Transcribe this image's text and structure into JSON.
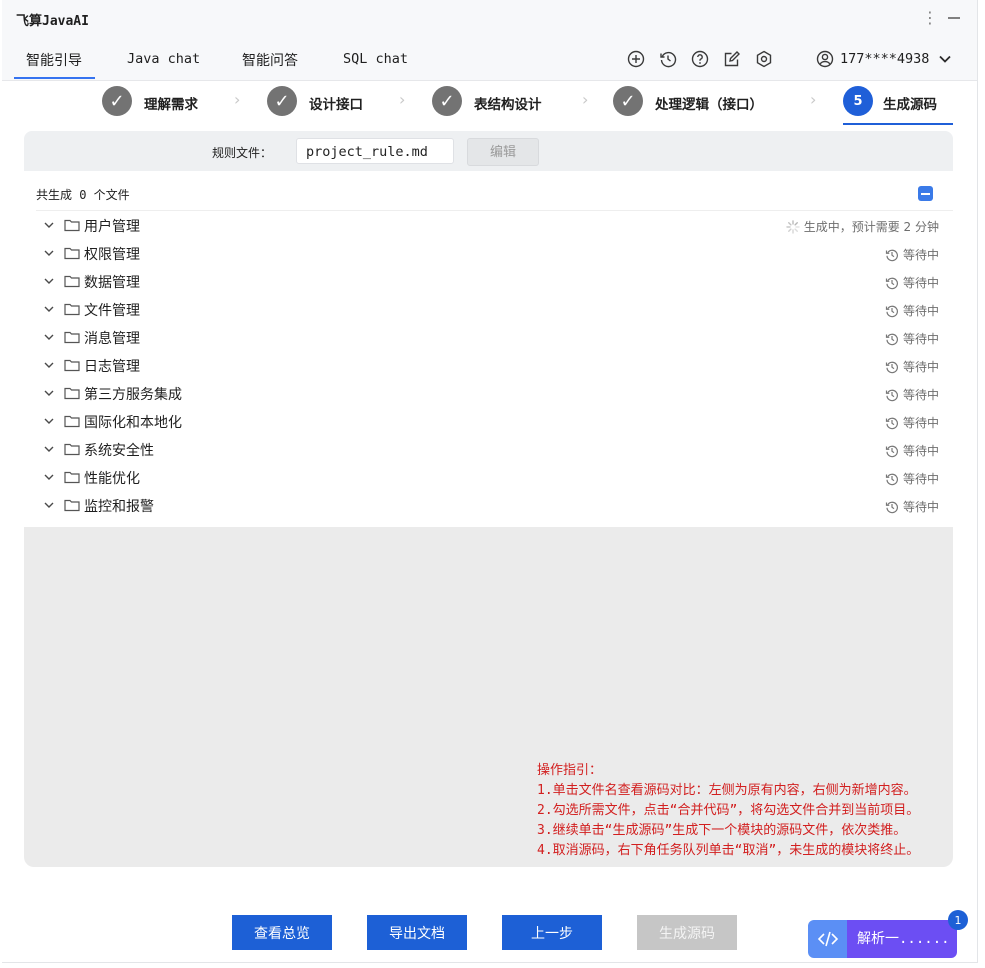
{
  "app": {
    "title": "飞算JavaAI"
  },
  "tabs": [
    {
      "label": "智能引导",
      "active": true
    },
    {
      "label": "Java chat"
    },
    {
      "label": "智能问答"
    },
    {
      "label": "SQL chat"
    }
  ],
  "toolbar": {
    "icons": [
      "add-circle-icon",
      "history-icon",
      "help-icon",
      "edit-icon",
      "settings-icon"
    ],
    "user_phone": "177****4938"
  },
  "steps": [
    {
      "label": "理解需求",
      "state": "done"
    },
    {
      "label": "设计接口",
      "state": "done"
    },
    {
      "label": "表结构设计",
      "state": "done"
    },
    {
      "label": "处理逻辑（接口）",
      "state": "done"
    },
    {
      "label": "生成源码",
      "state": "active",
      "number": "5"
    }
  ],
  "rule": {
    "label": "规则文件：",
    "value": "project_rule.md",
    "edit_label": "编辑"
  },
  "summary": "共生成 0 个文件",
  "modules": [
    {
      "name": "用户管理",
      "status": "生成中，预计需要 2 分钟",
      "state": "generating"
    },
    {
      "name": "权限管理",
      "status": "等待中",
      "state": "waiting"
    },
    {
      "name": "数据管理",
      "status": "等待中",
      "state": "waiting"
    },
    {
      "name": "文件管理",
      "status": "等待中",
      "state": "waiting"
    },
    {
      "name": "消息管理",
      "status": "等待中",
      "state": "waiting"
    },
    {
      "name": "日志管理",
      "status": "等待中",
      "state": "waiting"
    },
    {
      "name": "第三方服务集成",
      "status": "等待中",
      "state": "waiting"
    },
    {
      "name": "国际化和本地化",
      "status": "等待中",
      "state": "waiting"
    },
    {
      "name": "系统安全性",
      "status": "等待中",
      "state": "waiting"
    },
    {
      "name": "性能优化",
      "status": "等待中",
      "state": "waiting"
    },
    {
      "name": "监控和报警",
      "status": "等待中",
      "state": "waiting"
    }
  ],
  "guide": {
    "title": "操作指引：",
    "lines": [
      "1.单击文件名查看源码对比：左侧为原有内容，右侧为新增内容。",
      "2.勾选所需文件，点击“合并代码”，将勾选文件合并到当前项目。",
      "3.继续单击“生成源码”生成下一个模块的源码文件，依次类推。",
      "4.取消源码，右下角任务队列单击“取消”，未生成的模块将终止。"
    ]
  },
  "buttons": {
    "overview": "查看总览",
    "export": "导出文档",
    "prev": "上一步",
    "generate": "生成源码"
  },
  "task_queue": {
    "label": "解析一......",
    "badge": "1"
  },
  "colors": {
    "accent": "#1d60d6",
    "guide_text": "#d21f1f",
    "fab": "#6c4ef3"
  }
}
